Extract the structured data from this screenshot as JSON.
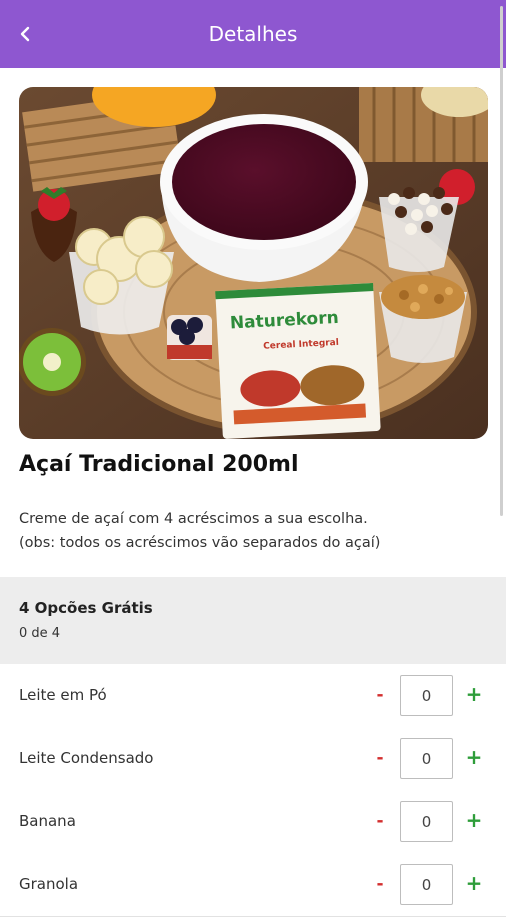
{
  "appbar": {
    "title": "Detalhes",
    "back_icon": "chevron-left-icon",
    "background_color": "#8e57d0"
  },
  "product": {
    "name": "Açaí Tradicional 200ml",
    "description_line1": "Creme de açaí com 4 acréscimos a sua escolha.",
    "description_line2": "(obs: todos os acréscimos vão separados do açaí)",
    "image_brand_text": "Naturekorn",
    "image_pouch_subtitle": "Cereal Integral"
  },
  "options_group": {
    "title": "4 Opcões Grátis",
    "selected_count": "0 de 4"
  },
  "options": [
    {
      "label": "Leite em Pó",
      "minus": "-",
      "quantity": "0",
      "plus": "+"
    },
    {
      "label": "Leite Condensado",
      "minus": "-",
      "quantity": "0",
      "plus": "+"
    },
    {
      "label": "Banana",
      "minus": "-",
      "quantity": "0",
      "plus": "+"
    },
    {
      "label": "Granola",
      "minus": "-",
      "quantity": "0",
      "plus": "+"
    }
  ],
  "colors": {
    "minus": "#d32f2f",
    "plus": "#2e9d3a",
    "group_header_bg": "#ededed"
  }
}
